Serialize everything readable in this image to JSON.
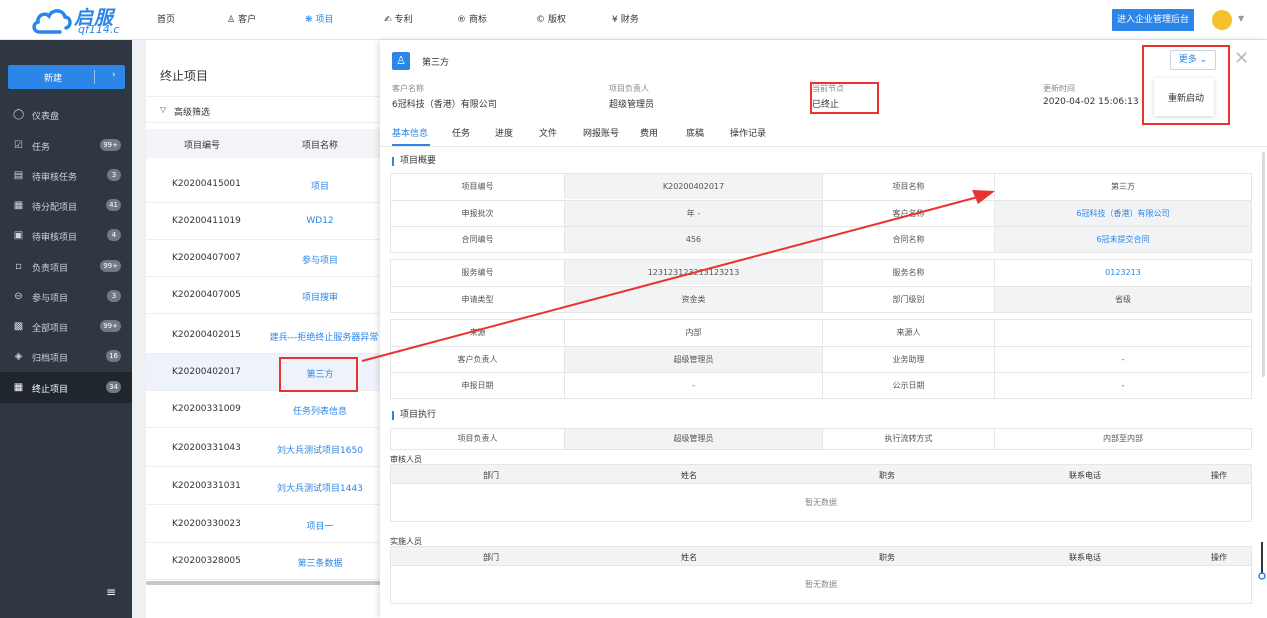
{
  "brand": {
    "name": "启服",
    "domain": "qf114.c",
    "accent": "#2b86e8"
  },
  "nav": {
    "items": [
      {
        "label": "首页",
        "icon": ""
      },
      {
        "label": "客户",
        "icon": "customer-icon"
      },
      {
        "label": "项目",
        "icon": "project-icon"
      },
      {
        "label": "专利",
        "icon": "patent-icon"
      },
      {
        "label": "商标",
        "icon": "trademark-icon"
      },
      {
        "label": "版权",
        "icon": "copyright-icon"
      },
      {
        "label": "财务",
        "icon": "finance-icon"
      }
    ],
    "active": "项目",
    "enter_admin": "进入企业管理后台"
  },
  "sidebar": {
    "new_label": "新建",
    "items": [
      {
        "label": "仪表盘",
        "badge": ""
      },
      {
        "label": "任务",
        "badge": "99+"
      },
      {
        "label": "待审核任务",
        "badge": "3"
      },
      {
        "label": "待分配项目",
        "badge": "41"
      },
      {
        "label": "待审核项目",
        "badge": "4"
      },
      {
        "label": "负责项目",
        "badge": "99+"
      },
      {
        "label": "参与项目",
        "badge": "3"
      },
      {
        "label": "全部项目",
        "badge": "99+"
      },
      {
        "label": "归档项目",
        "badge": "16"
      },
      {
        "label": "终止项目",
        "badge": "34"
      }
    ],
    "active": "终止项目"
  },
  "list": {
    "title": "终止项目",
    "filter": "高级筛选",
    "col_no": "项目编号",
    "col_name": "项目名称",
    "rows": [
      {
        "no": "K20200415001",
        "name": "项目"
      },
      {
        "no": "K20200411019",
        "name": "WD12"
      },
      {
        "no": "K20200407007",
        "name": "参与项目"
      },
      {
        "no": "K20200407005",
        "name": "项目搜审"
      },
      {
        "no": "K20200402015",
        "name": "建兵---拒绝终止服务器异常"
      },
      {
        "no": "K20200402017",
        "name": "第三方"
      },
      {
        "no": "K20200331009",
        "name": "任务列表信息"
      },
      {
        "no": "K20200331043",
        "name": "刘大兵测试项目1650"
      },
      {
        "no": "K20200331031",
        "name": "刘大兵测试项目1443"
      },
      {
        "no": "K20200330023",
        "name": "项目一"
      },
      {
        "no": "K20200328005",
        "name": "第三条数据"
      }
    ]
  },
  "detail": {
    "name": "第三方",
    "more": "更多",
    "restart": "重新启动",
    "info": [
      {
        "key": "客户名称",
        "value": "6冠科技（香港）有限公司"
      },
      {
        "key": "项目负责人",
        "value": "超级管理员"
      },
      {
        "key": "当前节点",
        "value": "已终止"
      },
      {
        "key": "更新时间",
        "value": "2020-04-02 15:06:13"
      }
    ],
    "tabs": [
      "基本信息",
      "任务",
      "进度",
      "文件",
      "网报账号",
      "费用",
      "底稿",
      "操作记录"
    ],
    "overview_title": "项目概要",
    "grid1": [
      [
        "项目编号",
        "K20200402017",
        "项目名称",
        "第三方"
      ],
      [
        "申报批次",
        "年 -",
        "客户名称",
        "6冠科技（香港）有限公司"
      ],
      [
        "合同编号",
        "456",
        "合同名称",
        "6冠未提交合同"
      ]
    ],
    "grid2": [
      [
        "服务编号",
        "123123123213123213",
        "服务名称",
        "0123213"
      ],
      [
        "申请类型",
        "资金类",
        "部门级别",
        "省级"
      ]
    ],
    "grid3": [
      [
        "来源",
        "内部",
        "来源人",
        ""
      ],
      [
        "客户负责人",
        "超级管理员",
        "业务助理",
        "-"
      ],
      [
        "申报日期",
        "-",
        "公示日期",
        "-"
      ]
    ],
    "exec_title": "项目执行",
    "exec_row": [
      "项目负责人",
      "超级管理员",
      "执行流转方式",
      "内部至内部"
    ],
    "reviewers_label": "审核人员",
    "implementers_label": "实施人员",
    "member_cols": [
      "部门",
      "姓名",
      "职务",
      "联系电话",
      "操作"
    ],
    "empty": "暂无数据"
  }
}
